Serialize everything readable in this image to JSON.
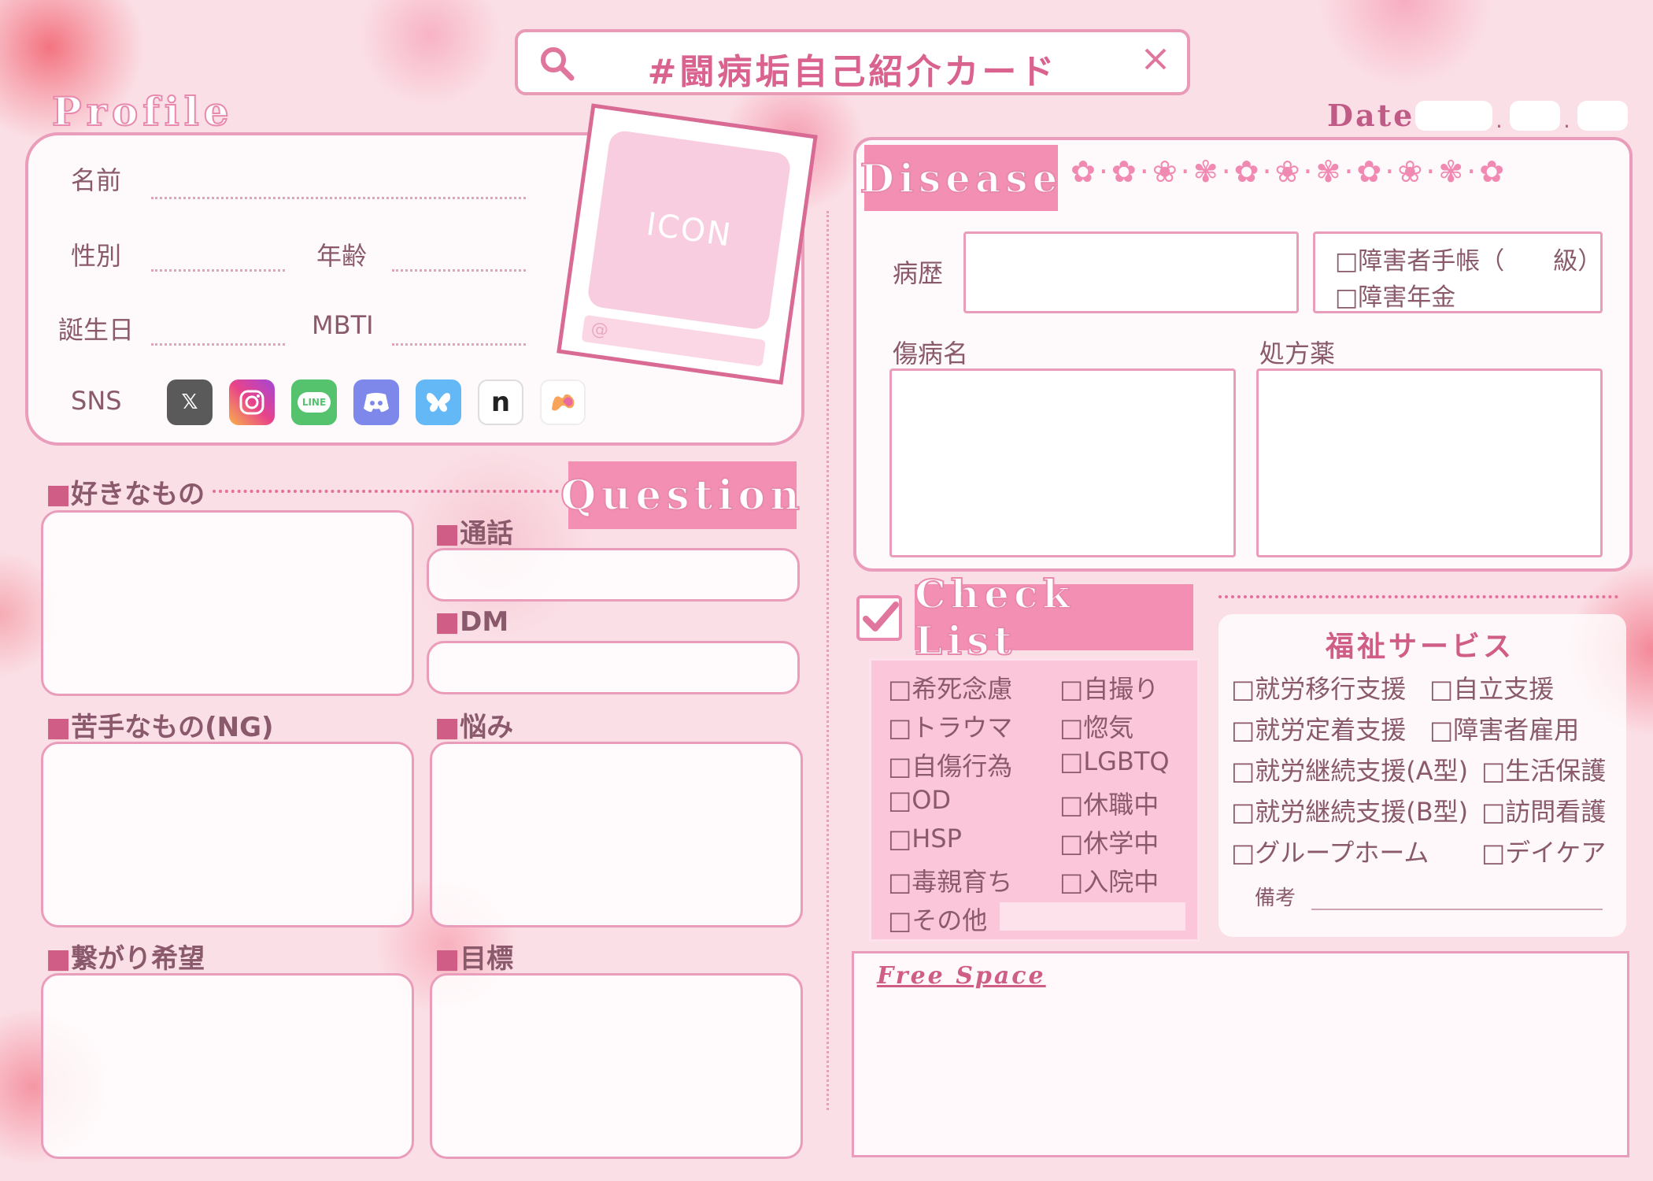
{
  "search": {
    "title": "#闘病垢自己紹介カード"
  },
  "date": {
    "label": "Date",
    "sep": "."
  },
  "profile": {
    "title": "Profile",
    "name_label": "名前",
    "gender_label": "性別",
    "age_label": "年齢",
    "birthday_label": "誕生日",
    "mbti_label": "MBTI",
    "sns_label": "SNS",
    "icon_text": "ICON",
    "icon_handle": "@",
    "sns_icons": [
      "x-icon",
      "instagram-icon",
      "line-icon",
      "discord-icon",
      "bluesky-icon",
      "note-icon",
      "misskey-icon"
    ],
    "line_text": "LINE"
  },
  "question": {
    "tab": "Question",
    "likes": "■好きなもの",
    "call": "■通話",
    "dm": "■DM",
    "dislikes": "■苦手なもの(NG)",
    "worries": "■悩み",
    "connect": "■繋がり希望",
    "goal": "■目標"
  },
  "disease": {
    "tab": "Disease",
    "history_label": "病歴",
    "handbook": "□障害者手帳（　　級）",
    "pension": "□障害年金",
    "illness_label": "傷病名",
    "medicine_label": "処方薬",
    "flowers": "✿·✿·❀·✾·✿·❀·✾·✿·❀·✾·✿"
  },
  "checklist": {
    "tab": "Check List",
    "col1": [
      "□希死念慮",
      "□トラウマ",
      "□自傷行為",
      "□OD",
      "□HSP",
      "□毒親育ち",
      "□その他"
    ],
    "col2": [
      "□自撮り",
      "□惚気",
      "□LGBTQ",
      "□休職中",
      "□休学中",
      "□入院中"
    ]
  },
  "welfare": {
    "title": "福祉サービス",
    "col1": [
      "□就労移行支援",
      "□就労定着支援",
      "□就労継続支援(A型)",
      "□就労継続支援(B型)",
      "□グループホーム"
    ],
    "col2": [
      "□自立支援",
      "□障害者雇用",
      "□生活保護",
      "□訪問看護",
      "□デイケア"
    ],
    "note_label": "備考"
  },
  "free": {
    "title": "Free Space"
  },
  "colors": {
    "accent": "#f28fb3",
    "border": "#ea9dbb",
    "text": "#8a5a6c",
    "pink_text": "#cf5d86"
  }
}
